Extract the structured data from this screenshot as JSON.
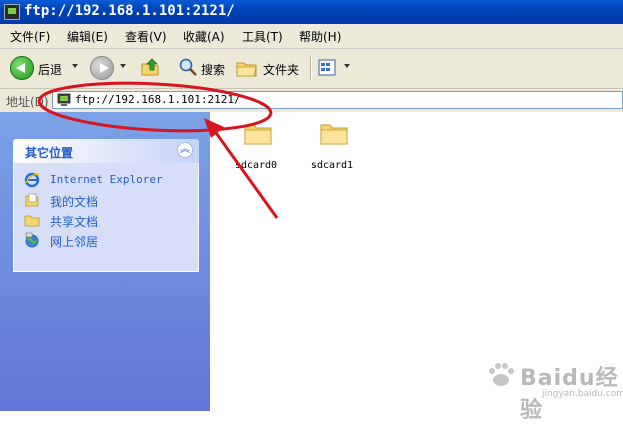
{
  "window": {
    "title": "ftp://192.168.1.101:2121/"
  },
  "menu": {
    "items": [
      "文件(F)",
      "编辑(E)",
      "查看(V)",
      "收藏(A)",
      "工具(T)",
      "帮助(H)"
    ]
  },
  "toolbar": {
    "back_label": "后退",
    "search_label": "搜索",
    "folders_label": "文件夹"
  },
  "address": {
    "label": "地址(D)",
    "value": "ftp://192.168.1.101:2121/"
  },
  "sidebar": {
    "panel_title": "其它位置",
    "items": [
      {
        "label": "Internet Explorer",
        "icon": "ie-icon"
      },
      {
        "label": "我的文档",
        "icon": "documents-icon"
      },
      {
        "label": "共享文档",
        "icon": "shared-folder-icon"
      },
      {
        "label": "网上邻居",
        "icon": "network-icon"
      }
    ]
  },
  "files": [
    {
      "name": "sdcard0",
      "icon": "folder-icon"
    },
    {
      "name": "sdcard1",
      "icon": "folder-icon"
    }
  ],
  "annotation": {
    "color": "#d8141e"
  },
  "watermark": {
    "brand": "Baidu经验",
    "url": "jingyan.baidu.com"
  }
}
